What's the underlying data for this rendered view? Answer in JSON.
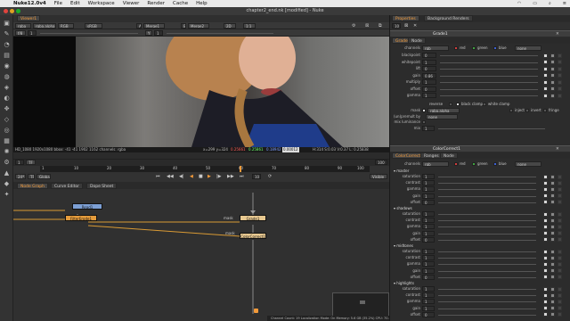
{
  "menubar": {
    "app": "Nuke12.0v4",
    "items": [
      "File",
      "Edit",
      "Workspace",
      "Viewer",
      "Render",
      "Cache",
      "Help"
    ],
    "right_icons": [
      "wifi-icon",
      "battery-icon",
      "search-icon",
      "menu-icon"
    ]
  },
  "window_title": "chapter2_end.nk [modified] - Nuke",
  "viewer": {
    "tab": "Viewer1",
    "channels": "rgba",
    "layer": "rgba.alpha",
    "display": "RGB",
    "colorspace": "sRGB",
    "input_a": "Merge1",
    "input_b": "Merge2",
    "gain": "f/8",
    "gain_value": "1",
    "gamma_label": "Y",
    "gamma_value": "1",
    "zoom": "2D",
    "scale": "1:1",
    "format_info": "HD_1080 1920x1080 bbox: -41 -41 1902 1162 channels: rgba",
    "coords": "x=299 y=324",
    "pixel_values": [
      "0.25661",
      "0.25861",
      "0.18942",
      "0.00012"
    ],
    "hsv": "H:314 S:0.03 V:0.37  L: 0.25838"
  },
  "timeline": {
    "frame": "1",
    "fps_label": "24*",
    "range_mode": "TF",
    "global": "Global",
    "increment": "10",
    "ticks": [
      "1",
      "10",
      "20",
      "30",
      "40",
      "50",
      "60",
      "70",
      "80",
      "90",
      "100"
    ],
    "end_frame": "100",
    "visible": "Visible"
  },
  "node_graph": {
    "tabs": [
      "Node Graph",
      "Curve Editor",
      "Dope Sheet"
    ],
    "nodes": [
      {
        "label": "Read1",
        "color": "#7c9fd4"
      },
      {
        "label": "FilterErode1",
        "color": "#e59c3c"
      },
      {
        "label": "Grade1",
        "color": "#e7c890"
      },
      {
        "label": "ColorCorrect1",
        "color": "#e7c890"
      }
    ],
    "mask_labels": [
      "mask",
      "mask"
    ],
    "status": "Channel Count: 19  Localization Mode: On  Memory: 5.6 GB (35.2%)  CPU: 70.8%  Disk: 1.2 MB/s  Network: 0.0 MB/s"
  },
  "properties": {
    "tabs": [
      "Properties",
      "Background Renders"
    ],
    "max_panels": "10",
    "grade": {
      "name": "Grade1",
      "tabs": [
        "Grade",
        "Node"
      ],
      "channels": "rgb",
      "rgb_labels": [
        "red",
        "green",
        "blue",
        "none"
      ],
      "rows": [
        {
          "label": "blackpoint",
          "value": "0"
        },
        {
          "label": "whitepoint",
          "value": "1"
        },
        {
          "label": "lift",
          "value": "0"
        },
        {
          "label": "gain",
          "value": "0.86"
        },
        {
          "label": "multiply",
          "value": "1"
        },
        {
          "label": "offset",
          "value": "0"
        },
        {
          "label": "gamma",
          "value": "1"
        }
      ],
      "reverse": "reverse",
      "black_clamp": "black clamp",
      "white_clamp": "white clamp",
      "mask_label": "mask",
      "mask_value": "rgba.alpha",
      "inject": "inject",
      "invert": "invert",
      "fringe": "fringe",
      "unpremult_label": "(un)premult by",
      "unpremult_value": "none",
      "mix_luminance": "mix luminance",
      "mix_label": "mix",
      "mix_value": "1"
    },
    "color_correct": {
      "name": "ColorCorrect1",
      "tabs": [
        "ColorCorrect",
        "Ranges",
        "Node"
      ],
      "channels": "rgb",
      "rgb_labels": [
        "red",
        "green",
        "blue",
        "none"
      ],
      "sections": [
        {
          "title": "master",
          "rows": [
            "saturation",
            "contrast",
            "gamma",
            "gain",
            "offset"
          ]
        },
        {
          "title": "shadows",
          "rows": [
            "saturation",
            "contrast",
            "gamma",
            "gain",
            "offset"
          ]
        },
        {
          "title": "midtones",
          "rows": [
            "saturation",
            "contrast",
            "gamma",
            "gain",
            "offset"
          ]
        },
        {
          "title": "highlights",
          "rows": [
            "saturation",
            "contrast",
            "gamma",
            "gain",
            "offset"
          ]
        }
      ],
      "row_values": {
        "saturation": "1",
        "contrast": "1",
        "gamma": "1",
        "gain": "1",
        "offset": "0"
      }
    }
  },
  "colors": {
    "accent": "#f29a3a",
    "viewer_bg": "#0a0a0a",
    "node_read": "#7c9fd4",
    "node_grade": "#e7c890"
  }
}
